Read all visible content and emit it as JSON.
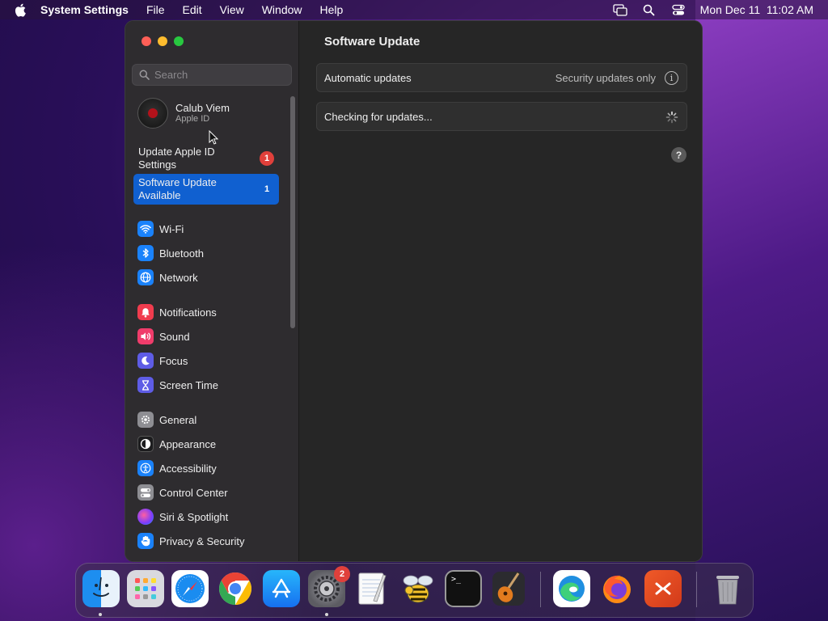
{
  "menubar": {
    "apple_icon": "apple-logo-icon",
    "app_name": "System Settings",
    "menus": [
      "File",
      "Edit",
      "View",
      "Window",
      "Help"
    ],
    "status_icons": [
      "screen-mirroring-icon",
      "spotlight-search-icon",
      "control-center-icon"
    ],
    "clock": "Mon Dec 11  11:02 AM"
  },
  "window": {
    "title": "Software Update",
    "sidebar": {
      "search_placeholder": "Search",
      "account": {
        "name": "Calub Viem",
        "subtitle": "Apple ID"
      },
      "notices": [
        {
          "label": "Update Apple ID Settings",
          "badge": "1",
          "selected": false
        },
        {
          "label": "Software Update Available",
          "badge": "1",
          "selected": true
        }
      ],
      "groups": [
        [
          {
            "label": "Wi-Fi",
            "icon": "wifi-icon",
            "color": "#1a82fb"
          },
          {
            "label": "Bluetooth",
            "icon": "bluetooth-icon",
            "color": "#1a82fb"
          },
          {
            "label": "Network",
            "icon": "globe-icon",
            "color": "#1a82fb"
          }
        ],
        [
          {
            "label": "Notifications",
            "icon": "bell-icon",
            "color": "#f03c4e"
          },
          {
            "label": "Sound",
            "icon": "speaker-icon",
            "color": "#f03c6b"
          },
          {
            "label": "Focus",
            "icon": "moon-icon",
            "color": "#5e5ce6"
          },
          {
            "label": "Screen Time",
            "icon": "hourglass-icon",
            "color": "#5e5ce6"
          }
        ],
        [
          {
            "label": "General",
            "icon": "gear-icon",
            "color": "#8e8e93"
          },
          {
            "label": "Appearance",
            "icon": "appearance-icon",
            "color": "#1c1c1e"
          },
          {
            "label": "Accessibility",
            "icon": "accessibility-icon",
            "color": "#1a82fb"
          },
          {
            "label": "Control Center",
            "icon": "control-center-icon",
            "color": "#8e8e93"
          },
          {
            "label": "Siri & Spotlight",
            "icon": "siri-icon",
            "color": "#a040d0"
          },
          {
            "label": "Privacy & Security",
            "icon": "hand-icon",
            "color": "#1a82fb"
          }
        ]
      ]
    },
    "main": {
      "automatic_updates": {
        "label": "Automatic updates",
        "value": "Security updates only",
        "icon": "info-icon"
      },
      "status": {
        "label": "Checking for updates...",
        "icon": "spinner-icon"
      },
      "help_label": "?"
    }
  },
  "dock": {
    "apps": [
      {
        "name": "Finder",
        "icon": "finder-icon",
        "running": true
      },
      {
        "name": "Launchpad",
        "icon": "launchpad-icon",
        "running": false
      },
      {
        "name": "Safari",
        "icon": "safari-icon",
        "running": false
      },
      {
        "name": "Google Chrome",
        "icon": "chrome-icon",
        "running": false
      },
      {
        "name": "App Store",
        "icon": "app-store-icon",
        "running": false
      },
      {
        "name": "System Settings",
        "icon": "system-settings-icon",
        "running": true,
        "badge": "2"
      },
      {
        "name": "TextEdit",
        "icon": "textedit-icon",
        "running": false
      },
      {
        "name": "Bee",
        "icon": "bee-icon",
        "running": false
      },
      {
        "name": "Terminal",
        "icon": "terminal-icon",
        "running": false
      },
      {
        "name": "GarageBand",
        "icon": "guitar-icon",
        "running": false
      },
      {
        "name": "Microsoft Edge",
        "icon": "edge-icon",
        "running": false
      },
      {
        "name": "Firefox",
        "icon": "firefox-icon",
        "running": false
      },
      {
        "name": "Remote Desktop",
        "icon": "remote-desktop-icon",
        "running": false
      },
      {
        "name": "Trash",
        "icon": "trash-icon",
        "running": false
      }
    ],
    "terminal_prompt": ">_"
  }
}
